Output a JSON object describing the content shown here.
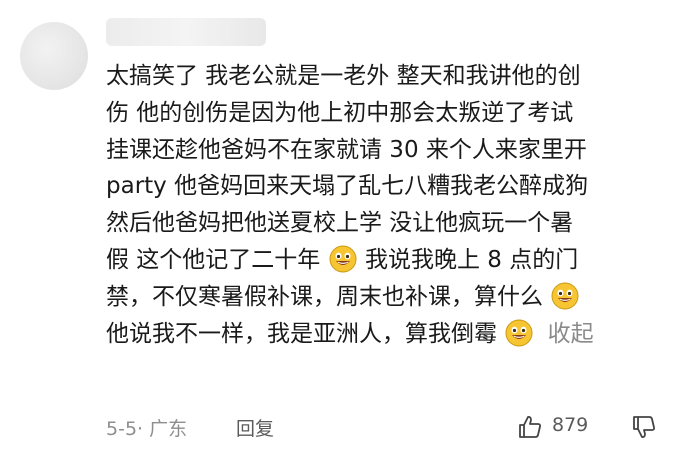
{
  "comment": {
    "lines": [
      "太搞笑了 我老公就是一老外 整天和我讲他的创",
      "伤 他的创伤是因为他上初中那会太叛逆了考试",
      "挂课还趁他爸妈不在家就请 30 来个人来家里开",
      "party 他爸妈回来天塌了乱七八糟我老公醉成狗",
      "然后他爸妈把他送夏校上学 没让他疯玩一个暑",
      "假 这个他记了二十年",
      "我说我晚上 8 点的门",
      "禁，不仅寒暑假补课，周末也补课，算什么",
      "他说我不一样，我是亚洲人，算我倒霉"
    ],
    "collapse_label": "收起",
    "emoji": "grinning-emoji-icon"
  },
  "footer": {
    "meta": "5-5· 广东",
    "reply_label": "回复",
    "like_count": "879"
  }
}
